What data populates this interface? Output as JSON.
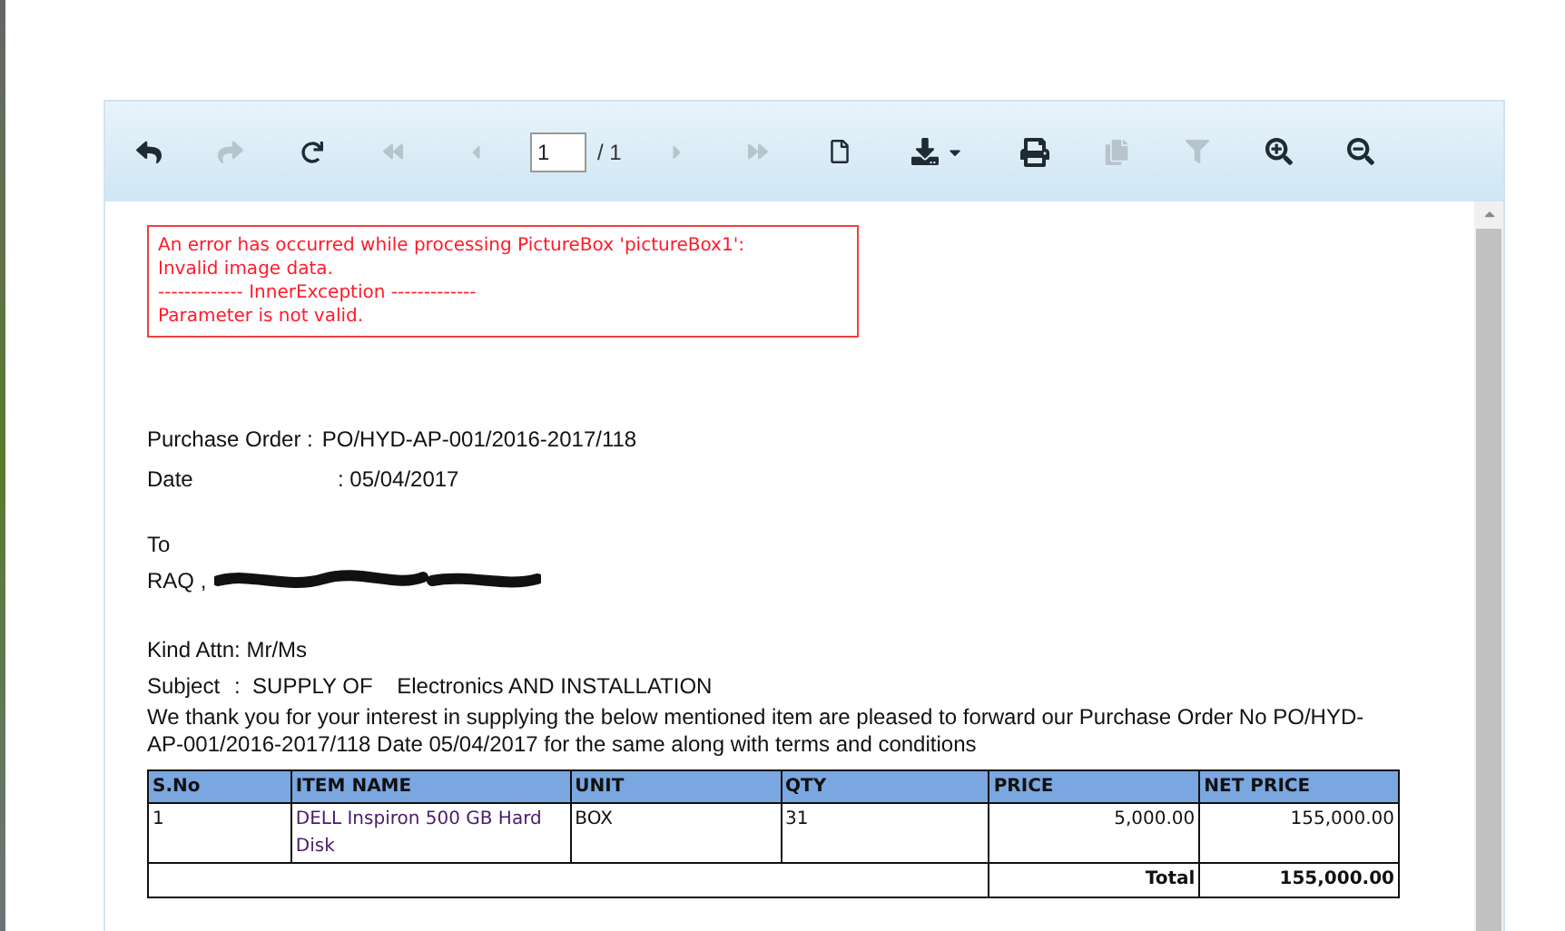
{
  "toolbar": {
    "items": [
      {
        "kind": "button",
        "disabled": false
      },
      {
        "kind": "button",
        "disabled": true
      },
      {
        "kind": "button",
        "disabled": false
      },
      {
        "kind": "button",
        "disabled": true
      },
      {
        "kind": "button",
        "disabled": true
      },
      {
        "kind": "page",
        "value": "1",
        "total": "/ 1"
      },
      {
        "kind": "button",
        "disabled": true
      },
      {
        "kind": "button",
        "disabled": true
      },
      {
        "kind": "button",
        "disabled": false
      },
      {
        "kind": "dropdown",
        "disabled": false
      },
      {
        "kind": "button",
        "disabled": false
      },
      {
        "kind": "button",
        "disabled": true
      },
      {
        "kind": "button",
        "disabled": true
      },
      {
        "kind": "button",
        "disabled": false
      },
      {
        "kind": "button",
        "disabled": false
      }
    ]
  },
  "error": {
    "lines": [
      "An error has occurred while processing PictureBox 'pictureBox1':",
      "Invalid image data.",
      "------------- InnerException -------------",
      "Parameter is not valid."
    ]
  },
  "report": {
    "purchase_order": {
      "label": "Purchase Order :",
      "value": "PO/HYD-AP-001/2016-2017/118"
    },
    "date": {
      "label": "Date",
      "value": ": 05/04/2017"
    },
    "to": "To",
    "recipient": "RAQ ,",
    "kind_attn": "Kind Attn: Mr/Ms",
    "subject": {
      "label": "Subject",
      "value": ":  SUPPLY OF    Electronics AND INSTALLATION"
    },
    "body": "We thank you for your interest in supplying the below mentioned item are pleased to forward our Purchase Order No PO/HYD-AP-001/2016-2017/118 Date 05/04/2017 for the same along with terms and conditions",
    "table": {
      "columns": [
        "S.No",
        "ITEM NAME",
        "UNIT",
        "QTY",
        "PRICE",
        "NET PRICE"
      ],
      "rows": [
        [
          "1",
          "DELL Inspiron 500 GB Hard Disk",
          "BOX",
          "31",
          "5,000.00",
          "155,000.00"
        ]
      ],
      "total": {
        "label": "Total",
        "value": "155,000.00"
      }
    }
  }
}
